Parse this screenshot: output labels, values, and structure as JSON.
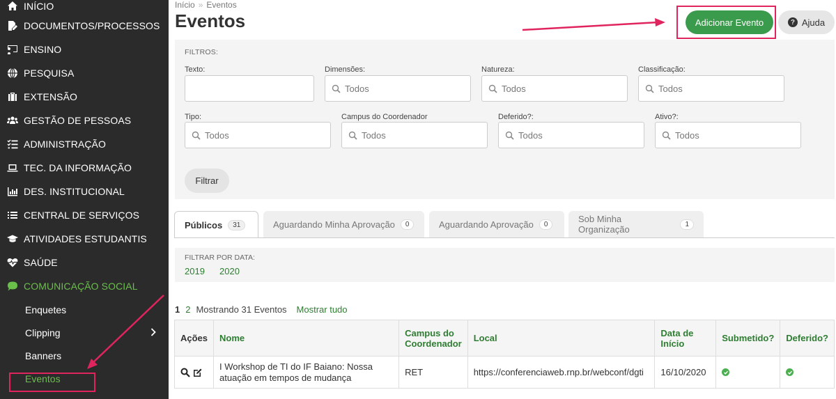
{
  "sidebar": {
    "items": [
      {
        "label": "INÍCIO",
        "icon": "home-icon"
      },
      {
        "label": "DOCUMENTOS/PROCESSOS",
        "icon": "document-edit-icon"
      },
      {
        "label": "ENSINO",
        "icon": "chalkboard-icon"
      },
      {
        "label": "PESQUISA",
        "icon": "globe-icon"
      },
      {
        "label": "EXTENSÃO",
        "icon": "briefcase-icon"
      },
      {
        "label": "GESTÃO DE PESSOAS",
        "icon": "users-icon"
      },
      {
        "label": "ADMINISTRAÇÃO",
        "icon": "list-check-icon"
      },
      {
        "label": "TEC. DA INFORMAÇÃO",
        "icon": "laptop-icon"
      },
      {
        "label": "DES. INSTITUCIONAL",
        "icon": "bar-chart-icon"
      },
      {
        "label": "CENTRAL DE SERVIÇOS",
        "icon": "list-icon"
      },
      {
        "label": "ATIVIDADES ESTUDANTIS",
        "icon": "graduation-cap-icon"
      },
      {
        "label": "SAÚDE",
        "icon": "heartbeat-icon"
      },
      {
        "label": "COMUNICAÇÃO SOCIAL",
        "icon": "comment-icon"
      }
    ],
    "subitems": [
      {
        "label": "Enquetes"
      },
      {
        "label": "Clipping"
      },
      {
        "label": "Banners"
      },
      {
        "label": "Eventos"
      }
    ],
    "active_color": "#6abf4b"
  },
  "breadcrumb": {
    "home": "Início",
    "sep": "»",
    "current": "Eventos"
  },
  "page_title": "Eventos",
  "actions": {
    "add_label": "Adicionar Evento",
    "help_label": "Ajuda",
    "help_glyph": "?"
  },
  "filters": {
    "title": "FILTROS:",
    "texto_label": "Texto:",
    "dimensoes_label": "Dimensões:",
    "natureza_label": "Natureza:",
    "classificacao_label": "Classificação:",
    "tipo_label": "Tipo:",
    "campus_label": "Campus do Coordenador",
    "deferido_label": "Deferido?:",
    "ativo_label": "Ativo?:",
    "all_placeholder": "Todos",
    "button_label": "Filtrar"
  },
  "tabs": [
    {
      "label": "Públicos",
      "count": "31"
    },
    {
      "label": "Aguardando Minha Aprovação",
      "count": "0"
    },
    {
      "label": "Aguardando Aprovação",
      "count": "0"
    },
    {
      "label": "Sob Minha Organização",
      "count": "1"
    }
  ],
  "date_filter": {
    "title": "FILTRAR POR DATA:",
    "years": [
      "2019",
      "2020"
    ]
  },
  "pager": {
    "page1": "1",
    "page2": "2",
    "summary": "Mostrando 31 Eventos",
    "show_all": "Mostrar tudo"
  },
  "table": {
    "headers": {
      "acoes": "Ações",
      "nome": "Nome",
      "campus": "Campus do Coordenador",
      "local": "Local",
      "data": "Data de Início",
      "submetido": "Submetido?",
      "deferido": "Deferido?"
    },
    "rows": [
      {
        "nome": "I Workshop de TI do IF Baiano: Nossa atuação em tempos de mudança",
        "campus": "RET",
        "local": "https://conferenciaweb.rnp.br/webconf/dgti",
        "data": "16/10/2020"
      }
    ]
  },
  "colors": {
    "brand_green": "#3a9b4c",
    "link_green": "#2f7d32",
    "annotation": "#e0245e",
    "sidebar_bg": "#2b2b2b"
  }
}
